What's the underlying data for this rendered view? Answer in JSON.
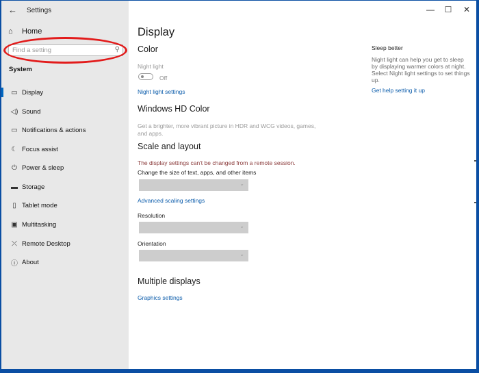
{
  "titlebar": {
    "back_icon": "←",
    "title": "Settings",
    "minimize": "—",
    "maximize": "☐",
    "close": "✕"
  },
  "sidebar": {
    "home_label": "Home",
    "search_placeholder": "Find a setting",
    "section_label": "System",
    "items": [
      {
        "label": "Display",
        "icon": "display-icon",
        "glyph": "▭"
      },
      {
        "label": "Sound",
        "icon": "sound-icon",
        "glyph": "🔊︎"
      },
      {
        "label": "Notifications & actions",
        "icon": "notifications-icon",
        "glyph": "▭"
      },
      {
        "label": "Focus assist",
        "icon": "focus-assist-icon",
        "glyph": "☾"
      },
      {
        "label": "Power & sleep",
        "icon": "power-icon",
        "glyph": "⏻"
      },
      {
        "label": "Storage",
        "icon": "storage-icon",
        "glyph": "▬"
      },
      {
        "label": "Tablet mode",
        "icon": "tablet-mode-icon",
        "glyph": "▯"
      },
      {
        "label": "Multitasking",
        "icon": "multitasking-icon",
        "glyph": "▣"
      },
      {
        "label": "Remote Desktop",
        "icon": "remote-desktop-icon",
        "glyph": "⤫"
      },
      {
        "label": "About",
        "icon": "about-icon",
        "glyph": "ⓘ"
      }
    ],
    "selected_index": 0
  },
  "main": {
    "page_title": "Display",
    "color_heading": "Color",
    "night_light_label": "Night light",
    "night_light_state": "Off",
    "night_light_settings_link": "Night light settings",
    "hd_heading": "Windows HD Color",
    "hd_desc_line1": "Get a brighter, more vibrant picture in HDR and WCG videos, games,",
    "hd_desc_line2": "and apps.",
    "scale_heading": "Scale and layout",
    "remote_warning": "The display settings can't be changed from a remote session.",
    "scale_label": "Change the size of text, apps, and other items",
    "advanced_scaling_link": "Advanced scaling settings",
    "resolution_label": "Resolution",
    "orientation_label": "Orientation",
    "multiple_heading": "Multiple displays",
    "graphics_link": "Graphics settings"
  },
  "right_panel": {
    "title": "Sleep better",
    "line1": "Night light can help you get to sleep",
    "line2": "by displaying warmer colors at night.",
    "line3": "Select Night light settings to set things",
    "line4": "up.",
    "help_link": "Get help setting it up"
  },
  "colors": {
    "accent": "#0067c0",
    "link": "#0b5cab",
    "annotation_circle": "#e21b1b",
    "desktop": "#0a4ea3"
  }
}
